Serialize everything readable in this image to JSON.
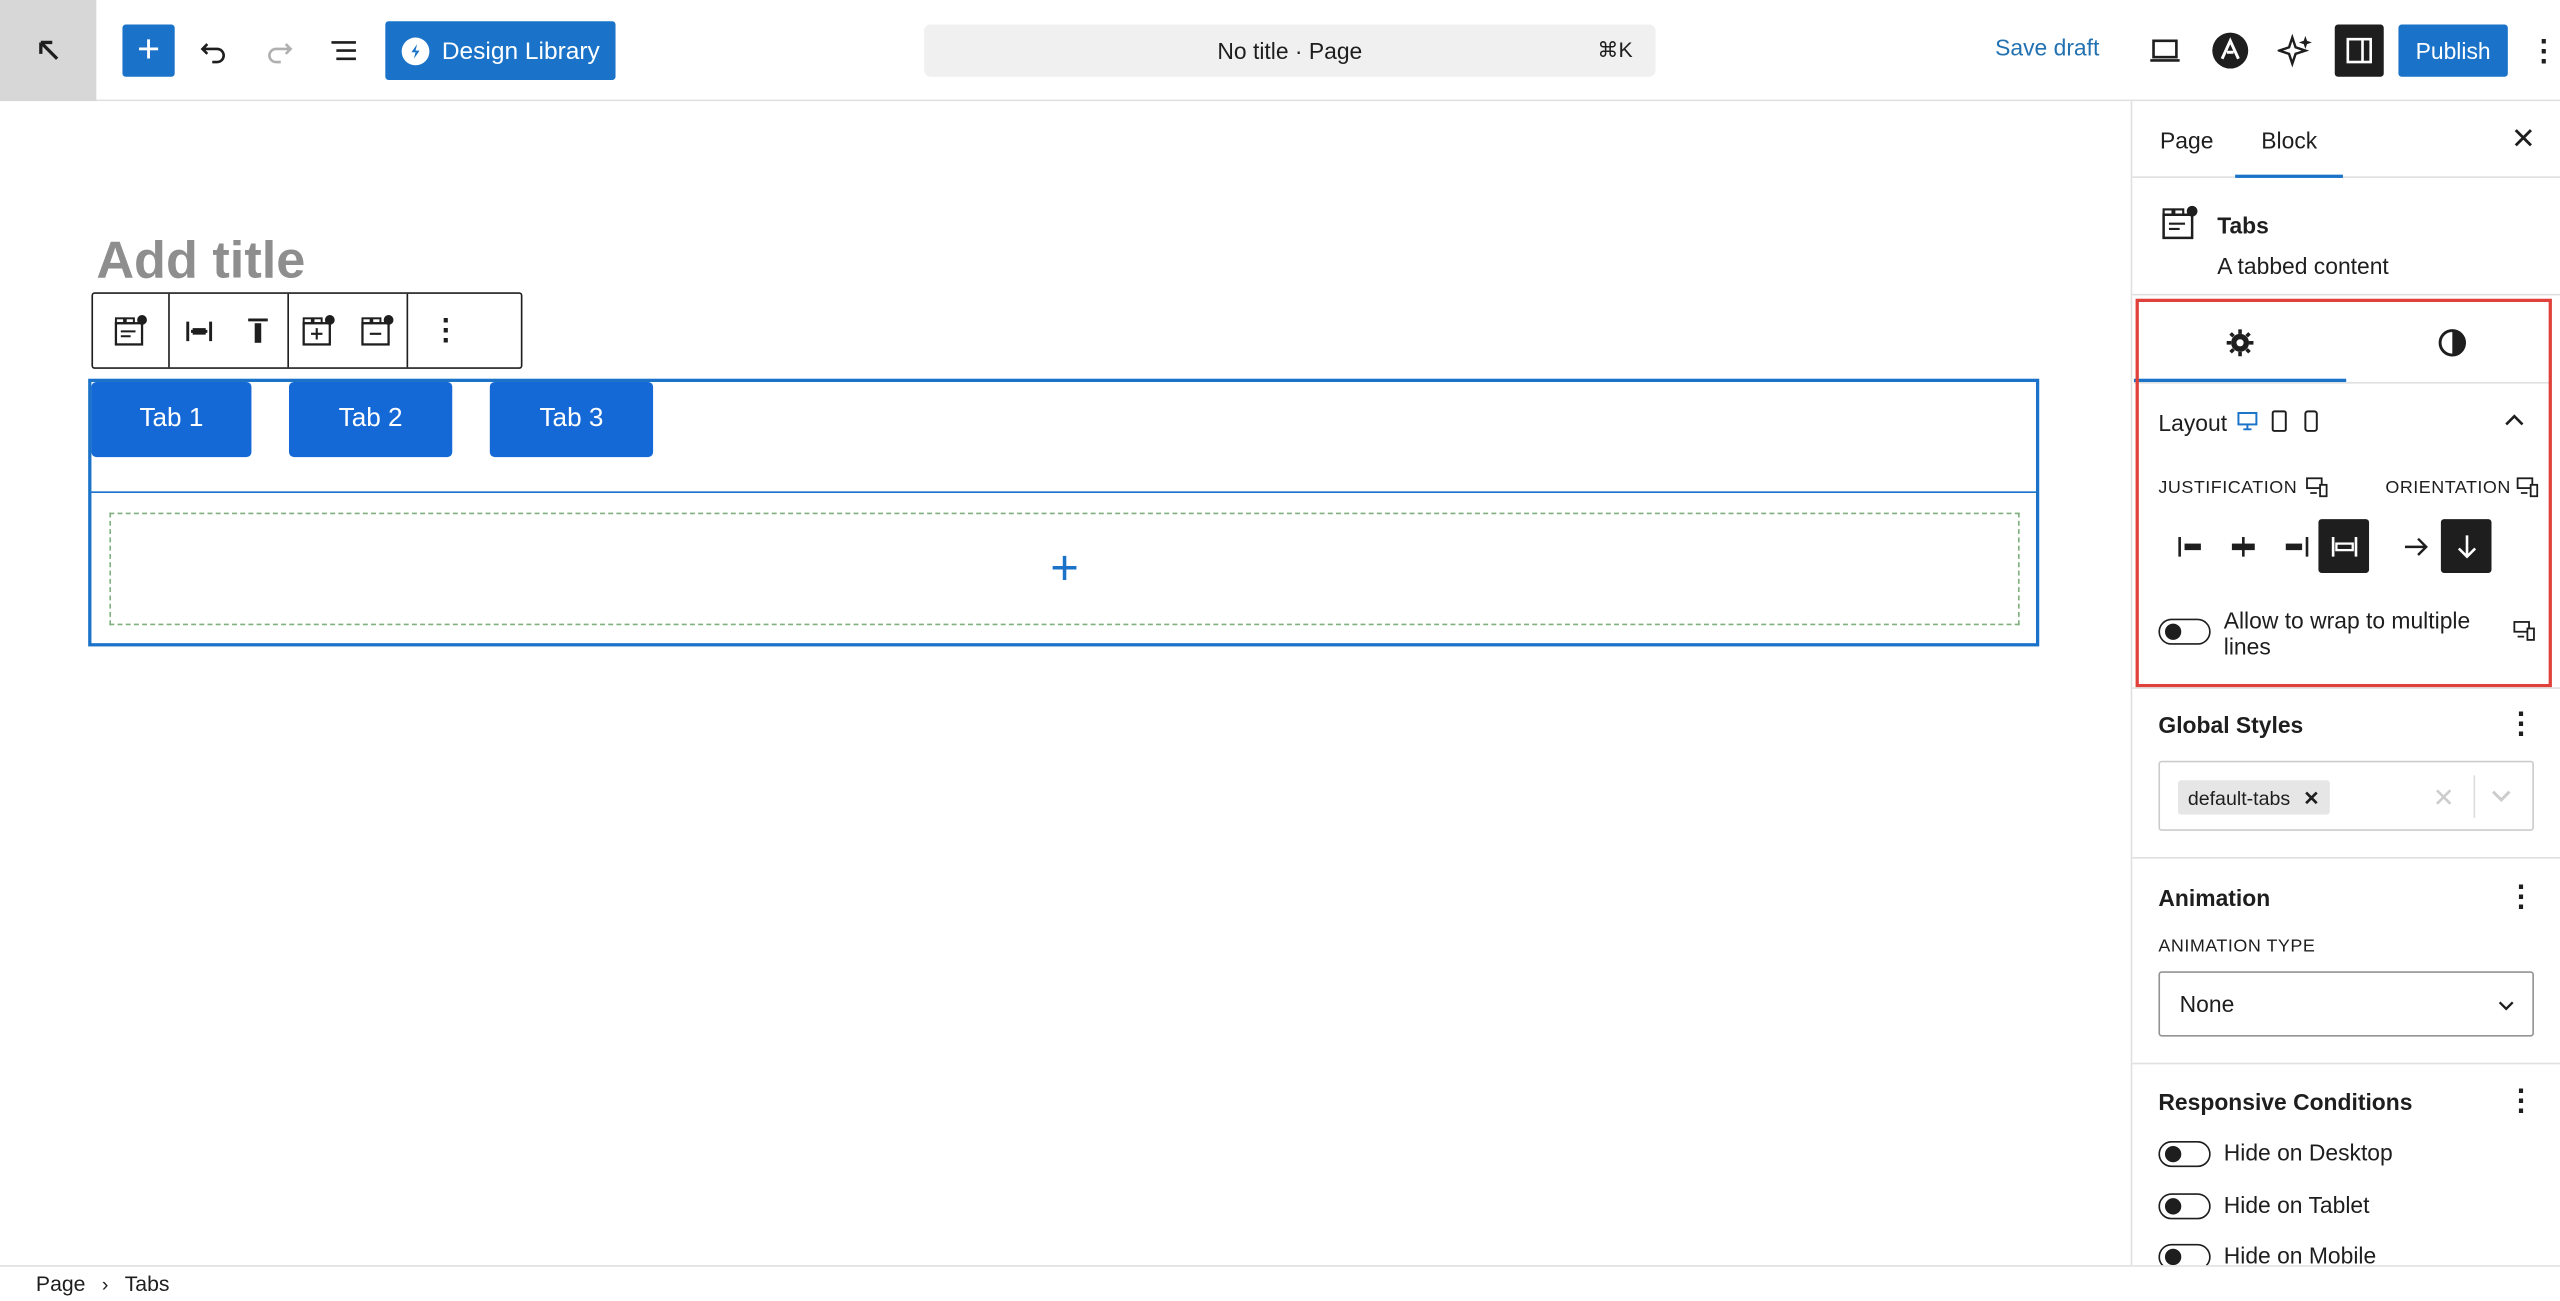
{
  "topbar": {
    "design_library_label": "Design Library",
    "doc_title": "No title · Page",
    "doc_shortcut": "⌘K",
    "save_draft": "Save draft",
    "publish": "Publish"
  },
  "editor": {
    "title_placeholder": "Add title",
    "tabs": [
      "Tab 1",
      "Tab 2",
      "Tab 3"
    ]
  },
  "breadcrumb": [
    "Page",
    "Tabs"
  ],
  "sidebar": {
    "tabs": [
      "Page",
      "Block"
    ],
    "active_tab": "Block",
    "block_name": "Tabs",
    "block_description": "A tabbed content",
    "layout_title": "Layout",
    "justification_label": "JUSTIFICATION",
    "orientation_label": "ORIENTATION",
    "justification_selected": "stretch",
    "orientation_selected": "vertical",
    "wrap_label": "Allow to wrap to multiple lines",
    "wrap_enabled": false,
    "global_styles_title": "Global Styles",
    "global_style_chip": "default-tabs",
    "animation_title": "Animation",
    "animation_type_label": "ANIMATION TYPE",
    "animation_type_value": "None",
    "responsive_title": "Responsive Conditions",
    "responsive_options": [
      "Hide on Desktop",
      "Hide on Tablet",
      "Hide on Mobile"
    ]
  },
  "colors": {
    "accent": "#1a73c8",
    "highlight_border": "#e0413b"
  }
}
